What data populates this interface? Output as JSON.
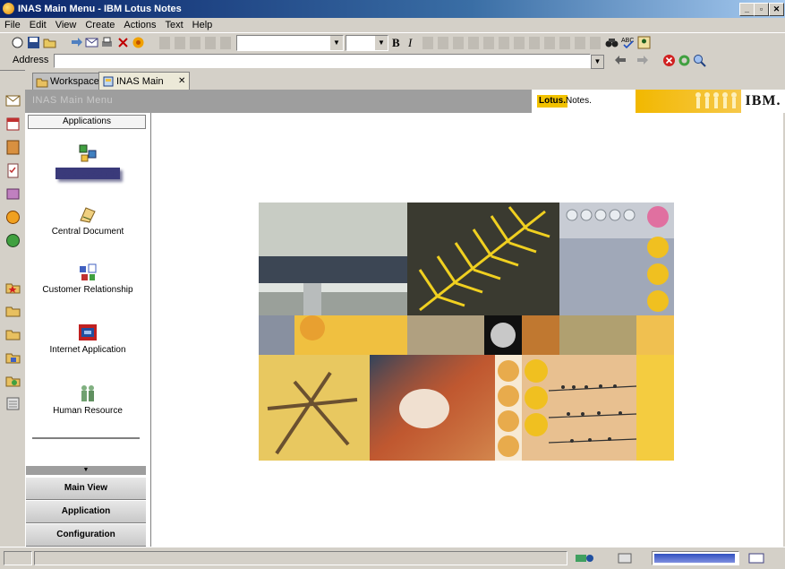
{
  "window": {
    "title": "INAS Main Menu - IBM Lotus Notes",
    "buttons": {
      "minimize": "_",
      "restore": "▫",
      "close": "✕"
    }
  },
  "menu": {
    "items": [
      "File",
      "Edit",
      "View",
      "Create",
      "Actions",
      "Text",
      "Help"
    ]
  },
  "toolbar": {
    "bold": "B",
    "italic": "I"
  },
  "address": {
    "label": "Address",
    "value": ""
  },
  "tabs": [
    {
      "label": "Workspace",
      "icon": "workspace-icon",
      "active": false
    },
    {
      "label": "INAS Main Menu",
      "icon": "database-icon",
      "active": true,
      "close": "✕"
    }
  ],
  "banner": {
    "frame_title": "INAS Main Menu",
    "lotus": "Lotus.",
    "notes": "Notes.",
    "ibm": "IBM."
  },
  "navigator": {
    "header": "Applications",
    "items": [
      {
        "label": "Sub-Systems",
        "icon": "subsystems-icon",
        "highlighted": true
      },
      {
        "label": "Central Document",
        "icon": "central-document-icon"
      },
      {
        "label": "Customer Relationship",
        "icon": "customer-relationship-icon"
      },
      {
        "label": "Internet Application",
        "icon": "internet-application-icon"
      },
      {
        "label": "Human Resource",
        "icon": "human-resource-icon"
      }
    ],
    "scroll_arrow": "▼",
    "buttons": [
      "Main View",
      "Application",
      "Configuration"
    ]
  },
  "colors": {
    "title_bar_start": "#0a246a",
    "title_bar_end": "#a6caf0",
    "lotus_yellow": "#f2c200",
    "chrome_gray": "#d4d0c8"
  }
}
